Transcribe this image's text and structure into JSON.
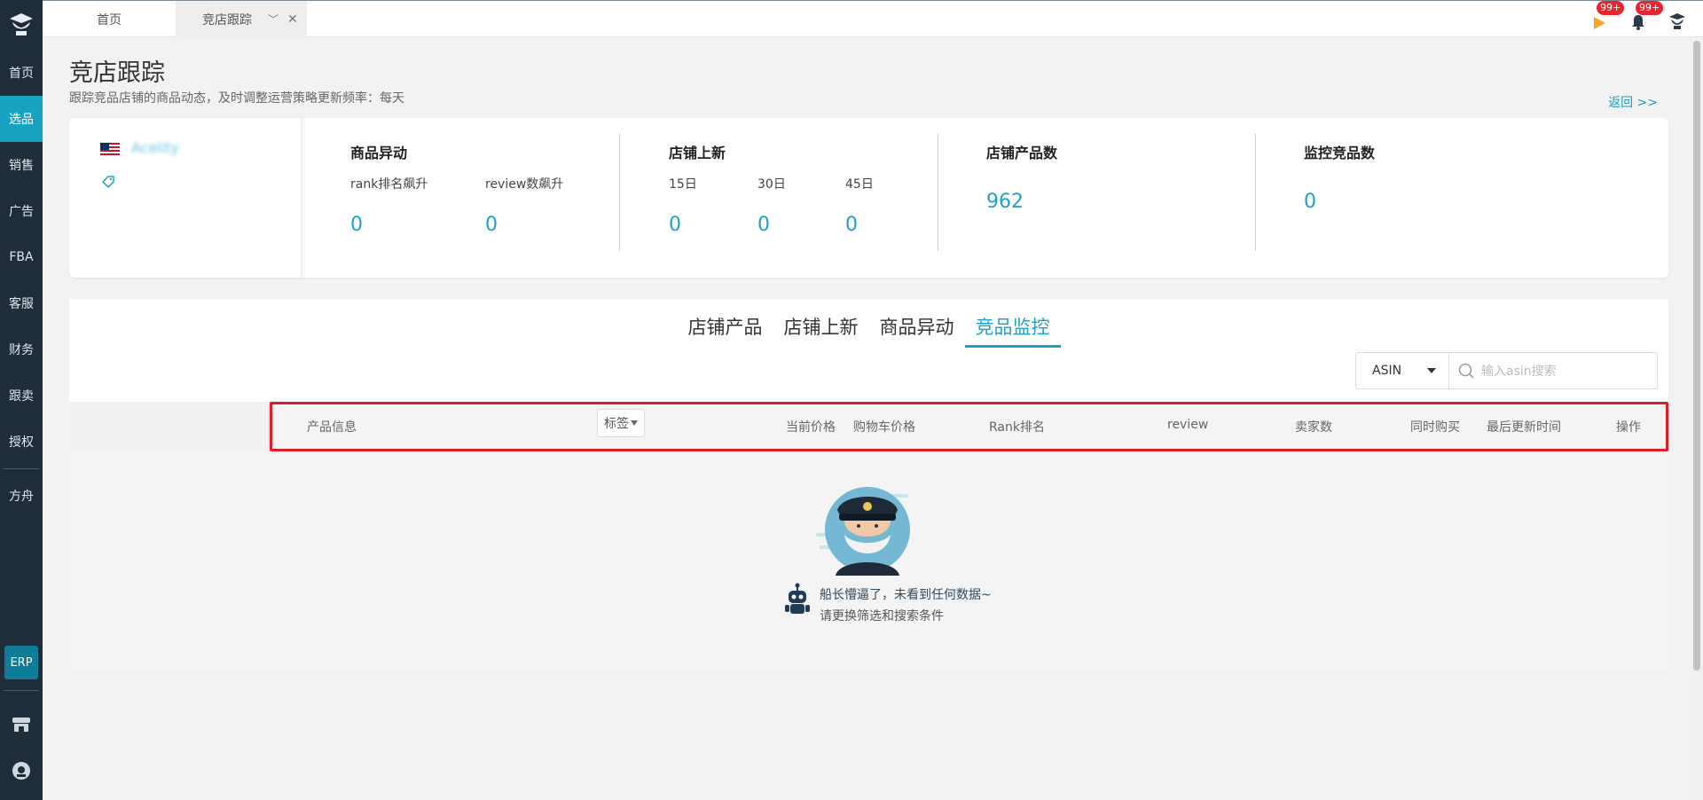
{
  "sidebar": {
    "items": [
      {
        "label": "首页"
      },
      {
        "label": "选品"
      },
      {
        "label": "销售"
      },
      {
        "label": "广告"
      },
      {
        "label": "FBA"
      },
      {
        "label": "客服"
      },
      {
        "label": "财务"
      },
      {
        "label": "跟卖"
      },
      {
        "label": "授权"
      },
      {
        "label": "方舟"
      }
    ],
    "erp_label": "ERP"
  },
  "topbar": {
    "tabs": [
      {
        "label": "首页"
      },
      {
        "label": "竞店跟踪"
      }
    ],
    "badges": {
      "flag": "99+",
      "bell": "99+"
    }
  },
  "page": {
    "title": "竞店跟踪",
    "subtitle": "跟踪竞品店铺的商品动态，及时调整运营策略更新频率：每天",
    "back_label": "返回 >>"
  },
  "store": {
    "name": "Acelity"
  },
  "stats": {
    "product_changes": {
      "title": "商品异动",
      "labels": [
        "rank排名飙升",
        "review数飙升"
      ],
      "values": [
        "0",
        "0"
      ]
    },
    "new_listings": {
      "title": "店铺上新",
      "labels": [
        "15日",
        "30日",
        "45日"
      ],
      "values": [
        "0",
        "0",
        "0"
      ]
    },
    "store_products": {
      "title": "店铺产品数",
      "value": "962"
    },
    "monitored": {
      "title": "监控竞品数",
      "value": "0"
    }
  },
  "panel": {
    "tabs": [
      {
        "label": "店铺产品"
      },
      {
        "label": "店铺上新"
      },
      {
        "label": "商品异动"
      },
      {
        "label": "竞品监控"
      }
    ],
    "search": {
      "type_selected": "ASIN",
      "placeholder": "输入asin搜索"
    },
    "columns": {
      "product_info": "产品信息",
      "tag": "标签",
      "current_price": "当前价格",
      "cart_price": "购物车价格",
      "rank": "Rank排名",
      "review": "review",
      "sellers": "卖家数",
      "bought_together": "同时购买",
      "last_updated": "最后更新时间",
      "actions": "操作"
    },
    "empty": {
      "line1": "船长懵逼了，未看到任何数据~",
      "line2": "请更换筛选和搜索条件"
    }
  }
}
